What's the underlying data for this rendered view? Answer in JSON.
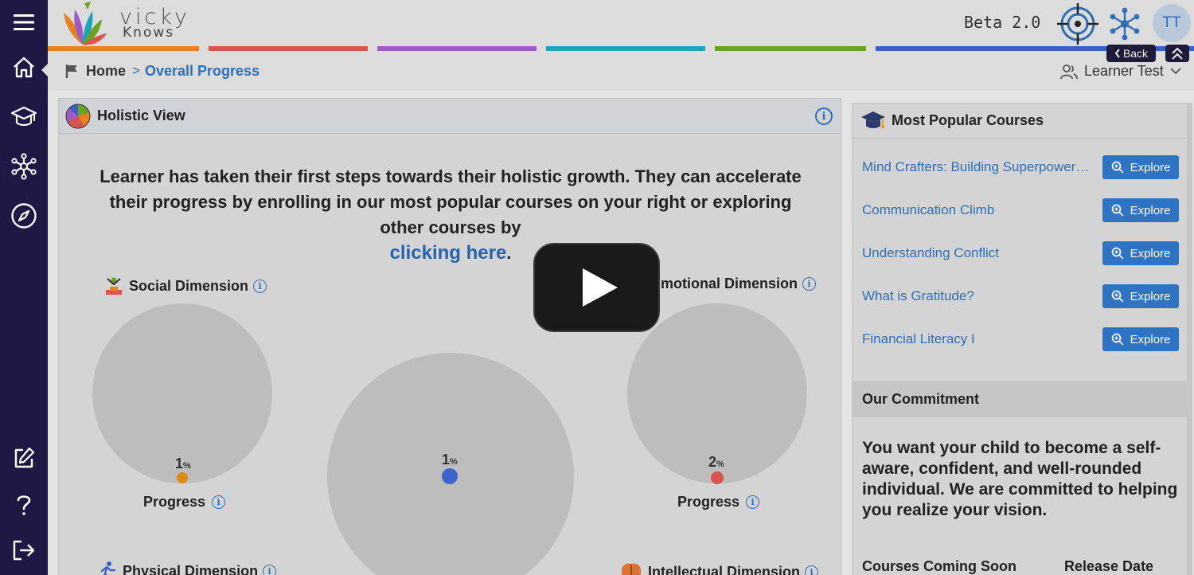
{
  "app": {
    "logo_line1": "vicky",
    "logo_line2": "Knows",
    "version": "Beta 2.0",
    "avatar_initials": "TT",
    "brand_strip_colors": [
      "#e8821e",
      "#d9534f",
      "#a05cc4",
      "#1fa5b8",
      "#6aa321",
      "#3b5ec9"
    ]
  },
  "sidebar": {
    "items": [
      {
        "icon": "menu-icon"
      },
      {
        "icon": "home-icon"
      },
      {
        "icon": "graduation-cap-icon"
      },
      {
        "icon": "network-icon"
      },
      {
        "icon": "compass-icon"
      },
      {
        "icon": "edit-icon"
      },
      {
        "icon": "help-icon"
      },
      {
        "icon": "logout-icon"
      }
    ]
  },
  "breadcrumb": {
    "home": "Home",
    "separator": ">",
    "current": "Overall Progress"
  },
  "header_controls": {
    "back_label": "Back",
    "user_name": "Learner Test"
  },
  "holistic": {
    "title": "Holistic View",
    "info": "i",
    "intro_text": "Learner has taken their first steps towards their holistic growth. They can accelerate their progress by enrolling in our most popular courses on your right or exploring other courses by",
    "intro_link": "clicking here",
    "intro_end": ".",
    "dimensions": [
      {
        "label": "Social Dimension",
        "percent": "1",
        "progress_label": "Progress",
        "color": "#e08a16"
      },
      {
        "label": "",
        "percent": "1",
        "progress_label": "",
        "color": "#3d63cc"
      },
      {
        "label": "motional Dimension",
        "percent": "2",
        "progress_label": "Progress",
        "color": "#d9534f"
      },
      {
        "label": "Physical Dimension"
      },
      {
        "label": "Intellectual Dimension"
      }
    ],
    "percent_unit": "%"
  },
  "popular": {
    "title": "Most Popular Courses",
    "explore_label": "Explore",
    "courses": [
      "Mind Crafters: Building Superpowere...",
      "Communication Climb",
      "Understanding Conflict",
      "What is Gratitude?",
      "Financial Literacy I"
    ]
  },
  "commitment": {
    "title": "Our Commitment",
    "text": "You want your child to become a self-aware, confident, and well-rounded individual. We are committed to helping you realize your vision.",
    "col_courses": "Courses Coming Soon",
    "col_release": "Release Date"
  }
}
